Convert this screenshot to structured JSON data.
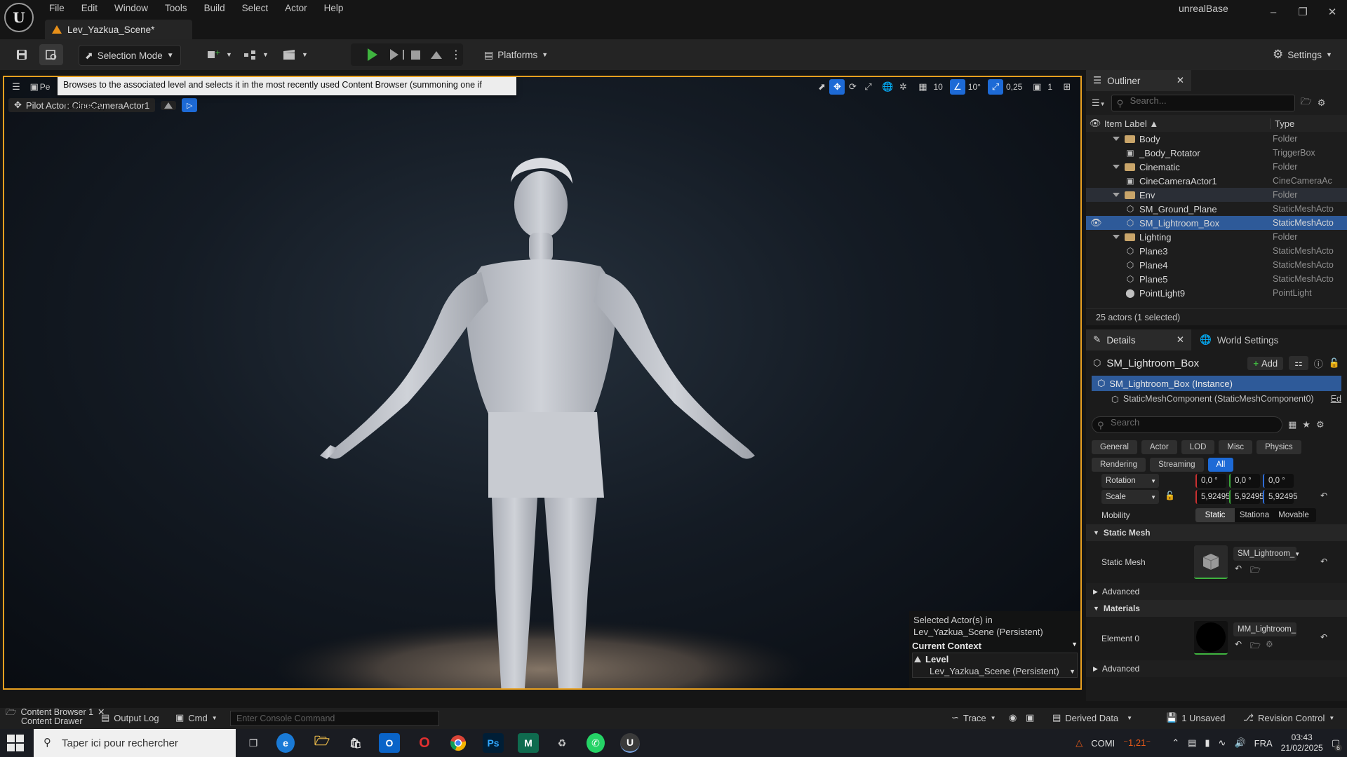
{
  "app": {
    "logo_letter": "U",
    "project_name": "unrealBase",
    "menu": [
      "File",
      "Edit",
      "Window",
      "Tools",
      "Build",
      "Select",
      "Actor",
      "Help"
    ],
    "level_tab": "Lev_Yazkua_Scene*"
  },
  "toolbar": {
    "selection_mode": "Selection Mode",
    "platforms": "Platforms",
    "settings": "Settings"
  },
  "viewport": {
    "perspective_label": "Pe",
    "tooltip": "Browses to the associated level and selects it in the most recently used Content Browser (summoning one if necessary)",
    "pilot_label": "Pilot Actor: CineCameraActor1",
    "grid_snap": "10",
    "rot_snap": "10°",
    "scale_snap": "0,25",
    "cam_speed": "1",
    "context": {
      "selected_line1": "Selected Actor(s) in",
      "selected_line2": "Lev_Yazkua_Scene (Persistent)",
      "current_context": "Current Context",
      "level_label": "Level",
      "level_value": "Lev_Yazkua_Scene (Persistent)"
    }
  },
  "outliner": {
    "title": "Outliner",
    "search_placeholder": "Search...",
    "col_label": "Item Label",
    "col_type": "Type",
    "rows": [
      {
        "label": "Body",
        "type": "Folder",
        "kind": "folder",
        "depth": 0
      },
      {
        "label": "_Body_Rotator",
        "type": "TriggerBox",
        "kind": "actor",
        "depth": 1
      },
      {
        "label": "Cinematic",
        "type": "Folder",
        "kind": "folder",
        "depth": 0
      },
      {
        "label": "CineCameraActor1",
        "type": "CineCameraAc",
        "kind": "camera",
        "depth": 1
      },
      {
        "label": "Env",
        "type": "Folder",
        "kind": "folder",
        "depth": 0
      },
      {
        "label": "SM_Ground_Plane",
        "type": "StaticMeshActo",
        "kind": "mesh",
        "depth": 1
      },
      {
        "label": "SM_Lightroom_Box",
        "type": "StaticMeshActo",
        "kind": "mesh",
        "depth": 1
      },
      {
        "label": "Lighting",
        "type": "Folder",
        "kind": "folder",
        "depth": 0
      },
      {
        "label": "Plane3",
        "type": "StaticMeshActo",
        "kind": "mesh",
        "depth": 1
      },
      {
        "label": "Plane4",
        "type": "StaticMeshActo",
        "kind": "mesh",
        "depth": 1
      },
      {
        "label": "Plane5",
        "type": "StaticMeshActo",
        "kind": "mesh",
        "depth": 1
      },
      {
        "label": "PointLight9",
        "type": "PointLight",
        "kind": "light",
        "depth": 1
      }
    ],
    "status": "25 actors (1 selected)"
  },
  "details": {
    "tab_details": "Details",
    "tab_world": "World Settings",
    "actor_name": "SM_Lightroom_Box",
    "add_label": "Add",
    "instance_row": "SM_Lightroom_Box (Instance)",
    "component_row": "StaticMeshComponent (StaticMeshComponent0)",
    "component_edit": "Ed",
    "search_placeholder": "Search",
    "categories_row1": [
      "General",
      "Actor",
      "LOD",
      "Misc",
      "Physics"
    ],
    "categories_row2": [
      "Rendering",
      "Streaming",
      "All"
    ],
    "rotation_label": "Rotation",
    "rotation_values": [
      "0,0 °",
      "0,0 °",
      "0,0 °"
    ],
    "scale_label": "Scale",
    "scale_values": [
      "5,92495",
      "5,92495",
      "5,92495"
    ],
    "mobility_label": "Mobility",
    "mobility_options": [
      "Static",
      "Stationa",
      "Movable"
    ],
    "static_mesh_section": "Static Mesh",
    "static_mesh_label": "Static Mesh",
    "static_mesh_value": "SM_Lightroom_",
    "advanced_label": "Advanced",
    "materials_section": "Materials",
    "element0_label": "Element 0",
    "element0_value": "MM_Lightroom_Box"
  },
  "bottom": {
    "content_browser": "Content Browser 1",
    "content_drawer": "Content Drawer",
    "output_log": "Output Log",
    "cmd": "Cmd",
    "console_placeholder": "Enter Console Command",
    "trace": "Trace",
    "derived_data": "Derived Data",
    "unsaved": "1 Unsaved",
    "revision_control": "Revision Control"
  },
  "taskbar": {
    "search_placeholder": "Taper ici pour rechercher",
    "stock": "COMI",
    "stock_change": "⁻1,21⁻",
    "lang": "FRA",
    "time": "03:43",
    "date": "21/02/2025",
    "notif_count": "6"
  }
}
